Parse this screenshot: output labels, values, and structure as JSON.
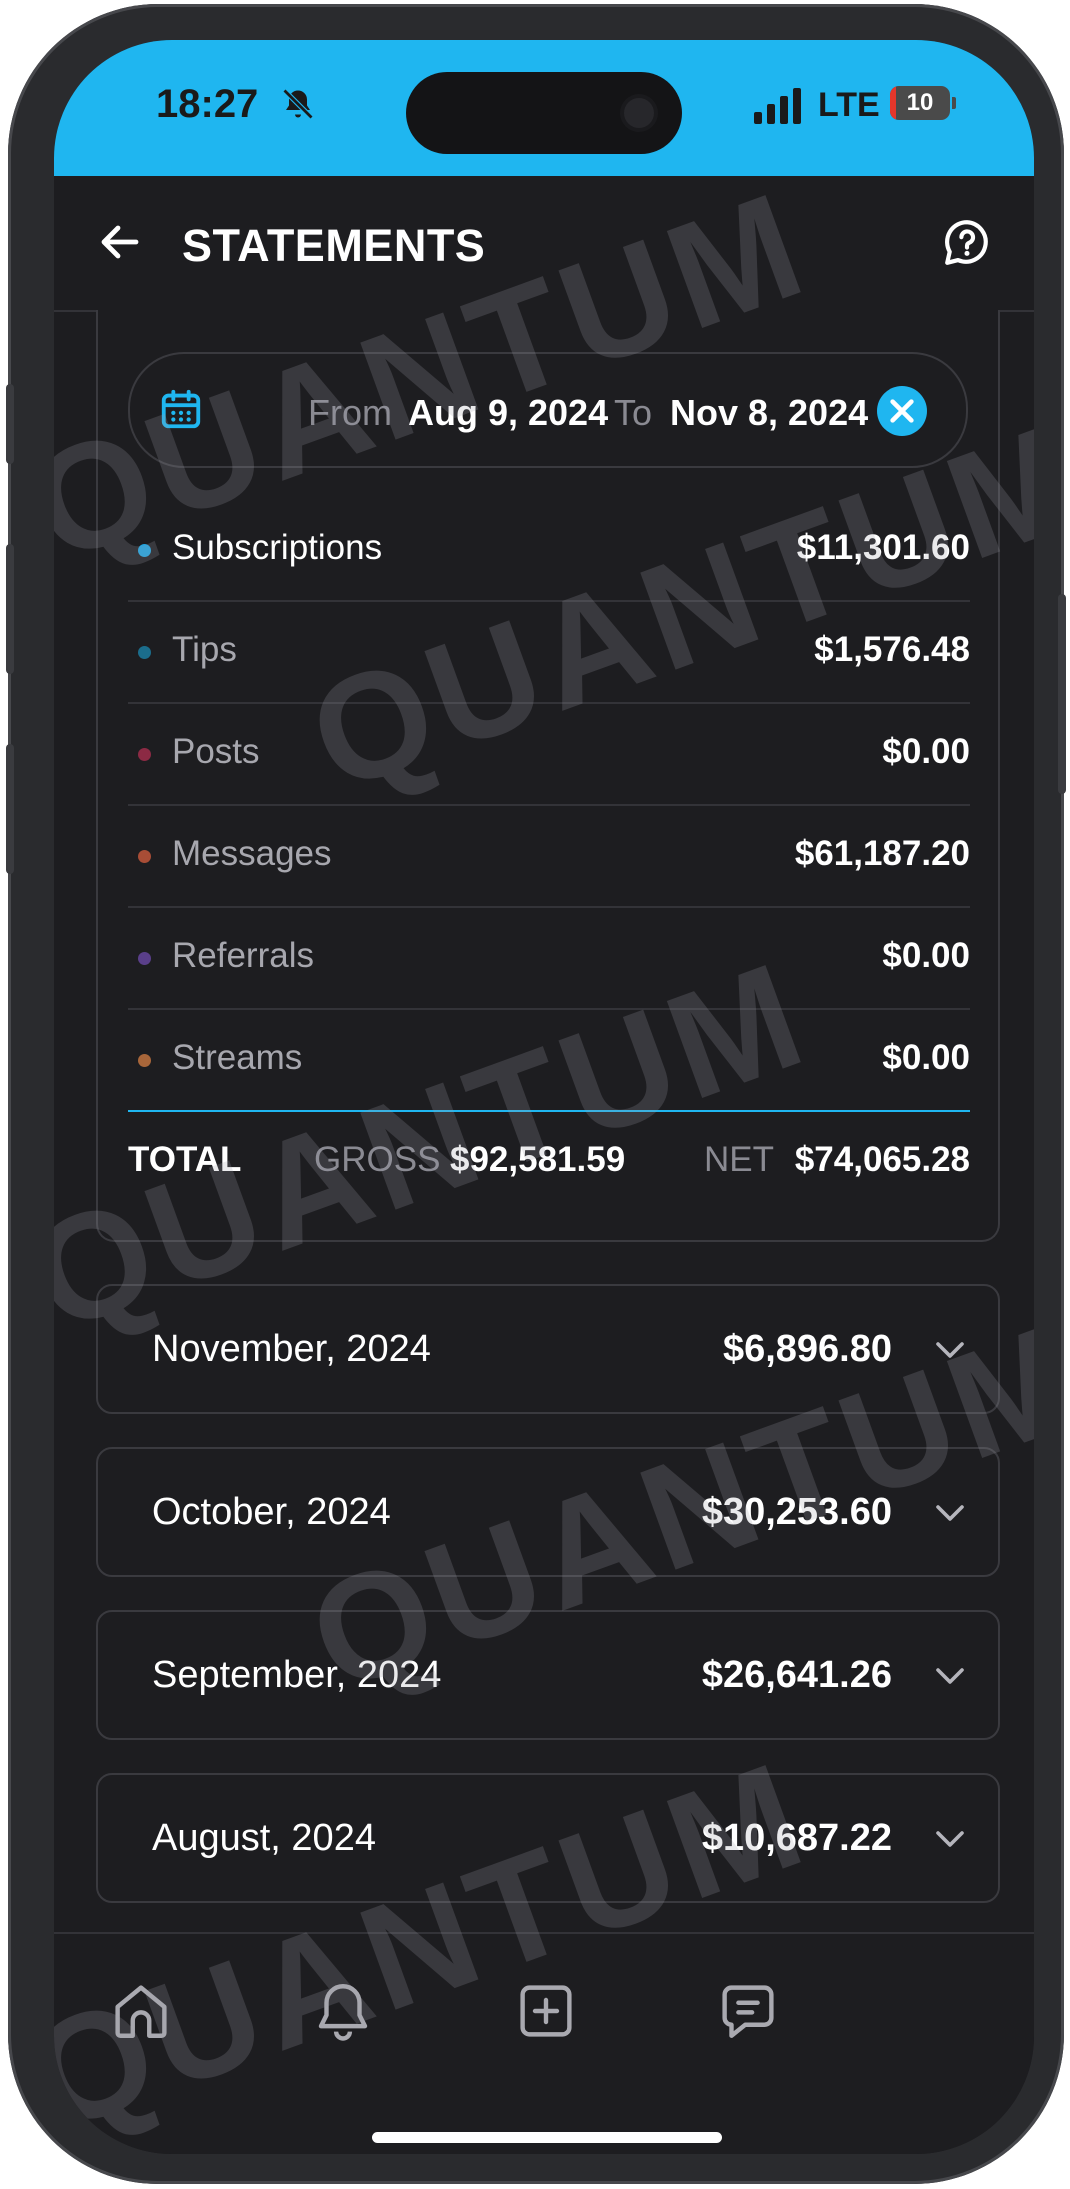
{
  "status_bar": {
    "time": "18:27",
    "network": "LTE",
    "battery": "10",
    "battery_level": 0.1,
    "background_color": "#1fb6f0",
    "icons": [
      "bell-off-icon",
      "signal-icon",
      "battery-icon"
    ]
  },
  "app_bar": {
    "title": "STATEMENTS",
    "icons": [
      "back-arrow-icon",
      "help-icon"
    ]
  },
  "date_range": {
    "from_label": "From",
    "from_value": "Aug 9, 2024",
    "to_label": "To",
    "to_value": "Nov 8, 2024",
    "icons": [
      "calendar-icon",
      "clear-icon"
    ]
  },
  "categories": [
    {
      "label": "Subscriptions",
      "value": "$11,301.60",
      "dot_color": "#1fa4e0"
    },
    {
      "label": "Tips",
      "value": "$1,576.48",
      "dot_color": "#1b6d8c"
    },
    {
      "label": "Posts",
      "value": "$0.00",
      "dot_color": "#8c2a44"
    },
    {
      "label": "Messages",
      "value": "$61,187.20",
      "dot_color": "#a84d36"
    },
    {
      "label": "Referrals",
      "value": "$0.00",
      "dot_color": "#5a3f8a"
    },
    {
      "label": "Streams",
      "value": "$0.00",
      "dot_color": "#a8663a"
    }
  ],
  "totals": {
    "label": "TOTAL",
    "gross_label": "GROSS",
    "gross_value": "$92,581.59",
    "net_label": "NET",
    "net_value": "$74,065.28"
  },
  "months": [
    {
      "name": "November, 2024",
      "amount": "$6,896.80"
    },
    {
      "name": "October, 2024",
      "amount": "$30,253.60"
    },
    {
      "name": "September, 2024",
      "amount": "$26,641.26"
    },
    {
      "name": "August, 2024",
      "amount": "$10,687.22"
    }
  ],
  "bottom_nav": {
    "icons": [
      "home-icon",
      "notifications-icon",
      "add-post-icon",
      "messages-icon"
    ]
  },
  "watermark": "QUANTUM",
  "colors": {
    "accent": "#1fb6f0",
    "background": "#1d1d20",
    "border": "#3a3a3f",
    "muted_text": "#8a8a92"
  }
}
